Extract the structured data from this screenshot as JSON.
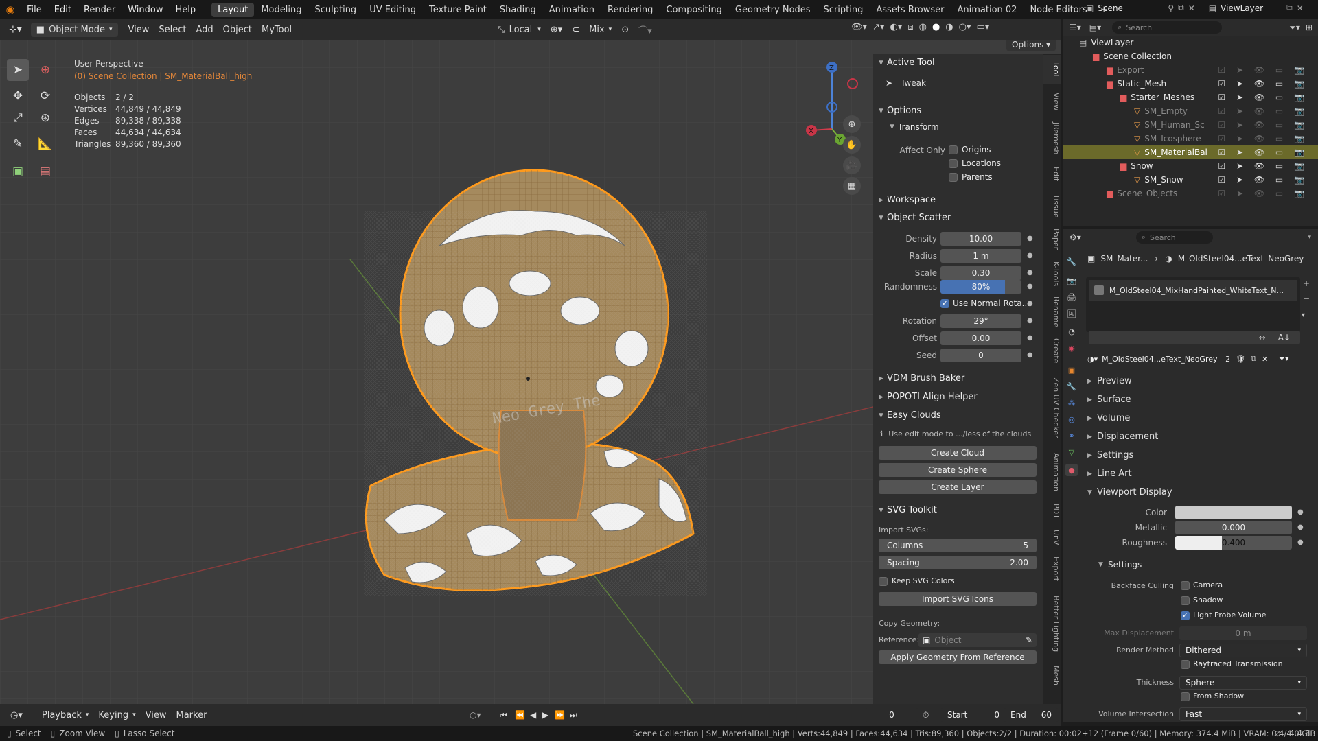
{
  "topbar": {
    "menus": [
      "File",
      "Edit",
      "Render",
      "Window",
      "Help"
    ],
    "workspaces": [
      "Layout",
      "Modeling",
      "Sculpting",
      "UV Editing",
      "Texture Paint",
      "Shading",
      "Animation",
      "Rendering",
      "Compositing",
      "Geometry Nodes",
      "Scripting",
      "Assets Browser",
      "Animation 02",
      "Node Editors"
    ],
    "add_tab": "+",
    "scene": "Scene",
    "view_layer": "ViewLayer"
  },
  "header3d": {
    "mode": "Object Mode",
    "menus": [
      "View",
      "Select",
      "Add",
      "Object",
      "MyTool"
    ],
    "transform_orientation": "Local",
    "pivot": "Mix",
    "options": "Options"
  },
  "viewport": {
    "perspective": "User Perspective",
    "context": "(0) Scene Collection | SM_MaterialBall_high",
    "stats": [
      {
        "label": "Objects",
        "value": "2 / 2"
      },
      {
        "label": "Vertices",
        "value": "44,849 / 44,849"
      },
      {
        "label": "Edges",
        "value": "89,338 / 89,338"
      },
      {
        "label": "Faces",
        "value": "44,634 / 44,634"
      },
      {
        "label": "Triangles",
        "value": "89,360 / 89,360"
      }
    ],
    "object_text": "Neo Grey The",
    "gizmo": {
      "x": "X",
      "y": "Y",
      "z": "Z"
    }
  },
  "npanel": {
    "active_tool": {
      "title": "Active Tool",
      "tool": "Tweak"
    },
    "options": {
      "title": "Options",
      "transform": "Transform",
      "affect_only": "Affect Only",
      "origins": "Origins",
      "locations": "Locations",
      "parents": "Parents"
    },
    "workspace": "Workspace",
    "object_scatter": {
      "title": "Object Scatter",
      "density": {
        "label": "Density",
        "value": "10.00"
      },
      "radius": {
        "label": "Radius",
        "value": "1 m"
      },
      "scale": {
        "label": "Scale",
        "value": "0.30"
      },
      "randomness": {
        "label": "Randomness",
        "value": "80%",
        "fraction": 0.8
      },
      "use_normal": "Use Normal Rota...",
      "rotation": {
        "label": "Rotation",
        "value": "29°"
      },
      "offset": {
        "label": "Offset",
        "value": "0.00"
      },
      "seed": {
        "label": "Seed",
        "value": "0"
      }
    },
    "vdm": "VDM Brush Baker",
    "popoti": "POPOTI Align Helper",
    "easy_clouds": {
      "title": "Easy Clouds",
      "info": "Use edit mode to .../less of the clouds",
      "create_cloud": "Create Cloud",
      "create_sphere": "Create Sphere",
      "create_layer": "Create Layer"
    },
    "svg": {
      "title": "SVG Toolkit",
      "import_label": "Import SVGs:",
      "columns": {
        "label": "Columns",
        "value": "5"
      },
      "spacing": {
        "label": "Spacing",
        "value": "2.00"
      },
      "keep_colors": "Keep SVG Colors",
      "import_icons": "Import SVG Icons"
    },
    "copy_geo": {
      "label": "Copy Geometry:",
      "reference_label": "Reference:",
      "reference_placeholder": "Object",
      "apply": "Apply Geometry From Reference"
    },
    "tabs": [
      "Tool",
      "View",
      "JRemesh",
      "Edit",
      "Tissue",
      "Paper",
      "K-Tools",
      "Rename",
      "Create",
      "Zen UV Checker",
      "Animation",
      "PDT",
      "UnV",
      "Export",
      "Better Lighting",
      "Mesh"
    ]
  },
  "outliner": {
    "search_placeholder": "Search",
    "rows": [
      {
        "name": "ViewLayer",
        "indent": 0,
        "kind": "layer"
      },
      {
        "name": "Scene Collection",
        "indent": 1,
        "kind": "collection"
      },
      {
        "name": "Export",
        "indent": 2,
        "kind": "collection",
        "dim": true
      },
      {
        "name": "Static_Mesh",
        "indent": 2,
        "kind": "collection"
      },
      {
        "name": "Starter_Meshes",
        "indent": 3,
        "kind": "collection"
      },
      {
        "name": "SM_Empty",
        "indent": 4,
        "kind": "mesh",
        "dim": true
      },
      {
        "name": "SM_Human_Sc",
        "indent": 4,
        "kind": "mesh",
        "dim": true
      },
      {
        "name": "SM_Icosphere",
        "indent": 4,
        "kind": "mesh",
        "dim": true
      },
      {
        "name": "SM_MaterialBal",
        "indent": 4,
        "kind": "mesh",
        "selected": true
      },
      {
        "name": "Snow",
        "indent": 3,
        "kind": "collection"
      },
      {
        "name": "SM_Snow",
        "indent": 4,
        "kind": "mesh"
      },
      {
        "name": "Scene_Objects",
        "indent": 2,
        "kind": "collection",
        "dim": true
      }
    ]
  },
  "properties": {
    "search_placeholder": "Search",
    "breadcrumb_obj": "SM_Mater...",
    "breadcrumb_mat": "M_OldSteel04...eText_NeoGrey",
    "slot": "M_OldSteel04_MixHandPainted_WhiteText_N...",
    "material_name": "M_OldSteel04...eText_NeoGrey",
    "users": "2",
    "panels": [
      "Preview",
      "Surface",
      "Volume",
      "Displacement",
      "Settings",
      "Line Art",
      "Viewport Display"
    ],
    "viewport_display": {
      "color": "Color",
      "metallic": {
        "label": "Metallic",
        "value": "0.000"
      },
      "roughness": {
        "label": "Roughness",
        "value": "0.400",
        "fraction": 0.4
      },
      "settings": "Settings",
      "backface": "Backface Culling",
      "camera": "Camera",
      "shadow": "Shadow",
      "light_probe": "Light Probe Volume",
      "max_disp": {
        "label": "Max Displacement",
        "value": "0 m"
      },
      "render_method": {
        "label": "Render Method",
        "value": "Dithered"
      },
      "raytraced": "Raytraced Transmission",
      "thickness": {
        "label": "Thickness",
        "value": "Sphere"
      },
      "from_shadow": "From Shadow",
      "volume_intersection": {
        "label": "Volume Intersection",
        "value": "Fast"
      }
    }
  },
  "timeline": {
    "menus": [
      "Playback",
      "Keying",
      "View",
      "Marker"
    ],
    "frame": "0",
    "start_label": "Start",
    "start": "0",
    "end_label": "End",
    "end": "60"
  },
  "status": {
    "select": "Select",
    "zoom": "Zoom View",
    "lasso": "Lasso Select",
    "info": "Scene Collection | SM_MaterialBall_high | Verts:44,849 | Faces:44,634 | Tris:89,360 | Objects:2/2 | Duration: 00:02+12 (Frame 0/60) | Memory: 374.4 MiB | VRAM: 0.4/4.0 GiB |",
    "version": "4.4.3"
  },
  "colors": {
    "accent": "#4772b3",
    "selection": "#ffa12d",
    "outliner_sel": "#6b6a2a"
  }
}
